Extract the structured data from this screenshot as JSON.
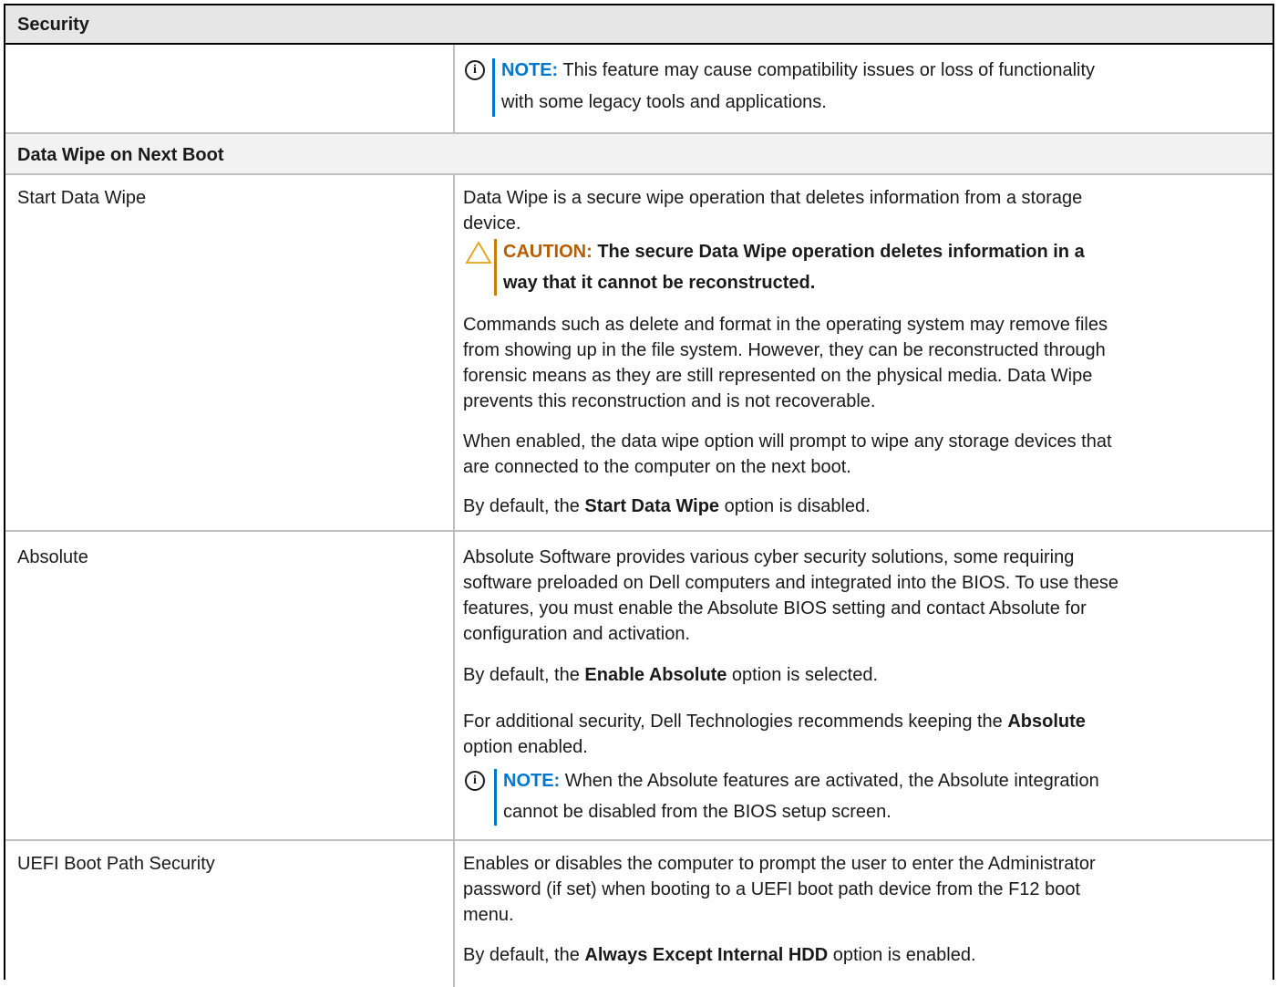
{
  "table": {
    "header": "Security",
    "top_note": {
      "label": "NOTE:",
      "line1": "This feature may cause compatibility issues or loss of functionality",
      "line2": "with some legacy tools and applications."
    },
    "section_title": "Data Wipe on Next Boot",
    "rows": [
      {
        "option": "Start Data Wipe",
        "desc_line1": "Data Wipe is a secure wipe operation that deletes information from a storage",
        "desc_line2": "device.",
        "caution": {
          "label": "CAUTION:",
          "line1": "The secure Data Wipe operation deletes information in a",
          "line2": "way that it cannot be reconstructed."
        },
        "para2_lines": [
          "Commands such as delete and format in the operating system may remove files",
          "from showing up in the file system. However, they can be reconstructed through",
          "forensic means as they are still represented on the physical media. Data Wipe",
          "prevents this reconstruction and is not recoverable."
        ],
        "para3_lines": [
          "When enabled, the data wipe option will prompt to wipe any storage devices that",
          "are connected to the computer on the next boot."
        ],
        "default_prefix": "By default, the ",
        "default_bold": "Start Data Wipe",
        "default_suffix": " option is disabled."
      },
      {
        "option": "Absolute",
        "para1_lines": [
          "Absolute Software provides various cyber security solutions, some requiring",
          "software preloaded on Dell computers and integrated into the BIOS. To use these",
          "features, you must enable the Absolute BIOS setting and contact Absolute for",
          "configuration and activation."
        ],
        "default_prefix": "By default, the ",
        "default_bold": "Enable Absolute",
        "default_suffix": " option is selected.",
        "rec_prefix": "For additional security, Dell Technologies recommends keeping the ",
        "rec_bold": "Absolute",
        "rec_line2": "option enabled.",
        "note": {
          "label": "NOTE:",
          "line1": "When the Absolute features are activated, the Absolute integration",
          "line2": "cannot be disabled from the BIOS setup screen."
        }
      },
      {
        "option": "UEFI Boot Path Security",
        "para1_lines": [
          "Enables or disables the computer to prompt the user to enter the Administrator",
          "password (if set) when booting to a UEFI boot path device from the F12 boot",
          "menu."
        ],
        "default_prefix": "By default, the ",
        "default_bold": "Always Except Internal HDD",
        "default_suffix": " option is enabled."
      }
    ]
  },
  "colors": {
    "note_blue": "#0076ce",
    "caution_orange": "#b85c00",
    "header_bg": "#e6e6e6",
    "section_bg": "#f2f2f2"
  },
  "icons": {
    "note": "info-circle-icon",
    "caution": "warning-triangle-icon"
  }
}
